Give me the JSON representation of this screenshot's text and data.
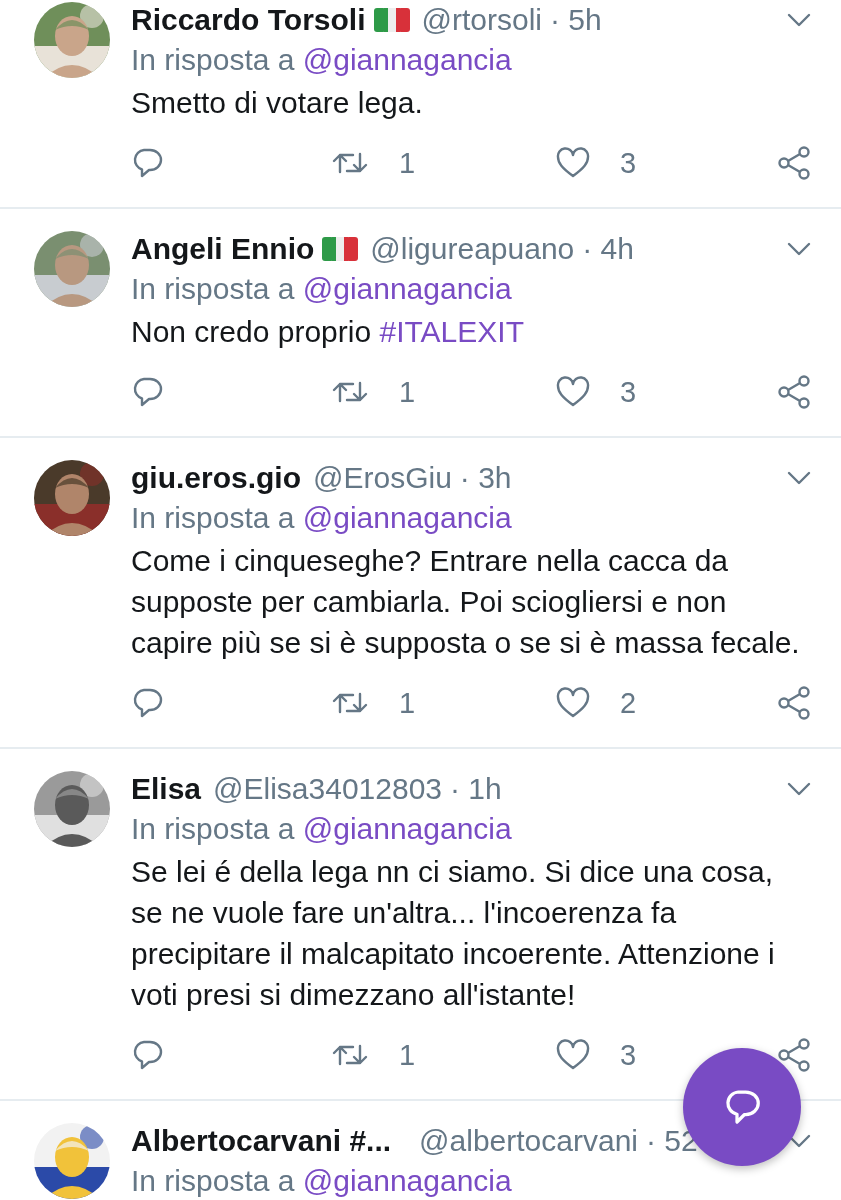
{
  "tweets": [
    {
      "name": "Riccardo Torsoli",
      "flag": true,
      "handle": "@rtorsoli",
      "time": "· 5h",
      "reply_prefix": "In risposta a",
      "reply_to": "@giannagancia",
      "body": "Smetto di votare lega.",
      "retweets": "1",
      "likes": "3"
    },
    {
      "name": "Angeli Ennio",
      "flag": true,
      "handle": "@ligureapuano",
      "time": "· 4h",
      "reply_prefix": "In risposta a",
      "reply_to": "@giannagancia",
      "body": "Non credo proprio ",
      "hashtag": "#ITALEXIT",
      "retweets": "1",
      "likes": "3"
    },
    {
      "name": "giu.eros.gio",
      "flag": false,
      "handle": "@ErosGiu",
      "time": "· 3h",
      "reply_prefix": "In risposta a",
      "reply_to": "@giannagancia",
      "body": "Come i cinqueseghe? Entrare nella cacca da supposte per cambiarla. Poi sciogliersi e non capire più se si è supposta o se si è massa fecale.",
      "retweets": "1",
      "likes": "2"
    },
    {
      "name": "Elisa",
      "flag": false,
      "handle": "@Elisa34012803",
      "time": "· 1h",
      "reply_prefix": "In risposta a",
      "reply_to": "@giannagancia",
      "body": "Se lei é  della lega nn ci siamo. Si dice una cosa, se ne vuole fare un'altra... l'incoerenza fa precipitare il malcapitato incoerente. Attenzione i voti presi si dimezzano all'istante!",
      "retweets": "1",
      "likes": "3"
    },
    {
      "name": "Albertocarvani #...",
      "flag": false,
      "handle": "@albertocarvani",
      "time": "· 52",
      "reply_prefix": "In risposta a",
      "reply_to": "@giannagancia"
    }
  ]
}
